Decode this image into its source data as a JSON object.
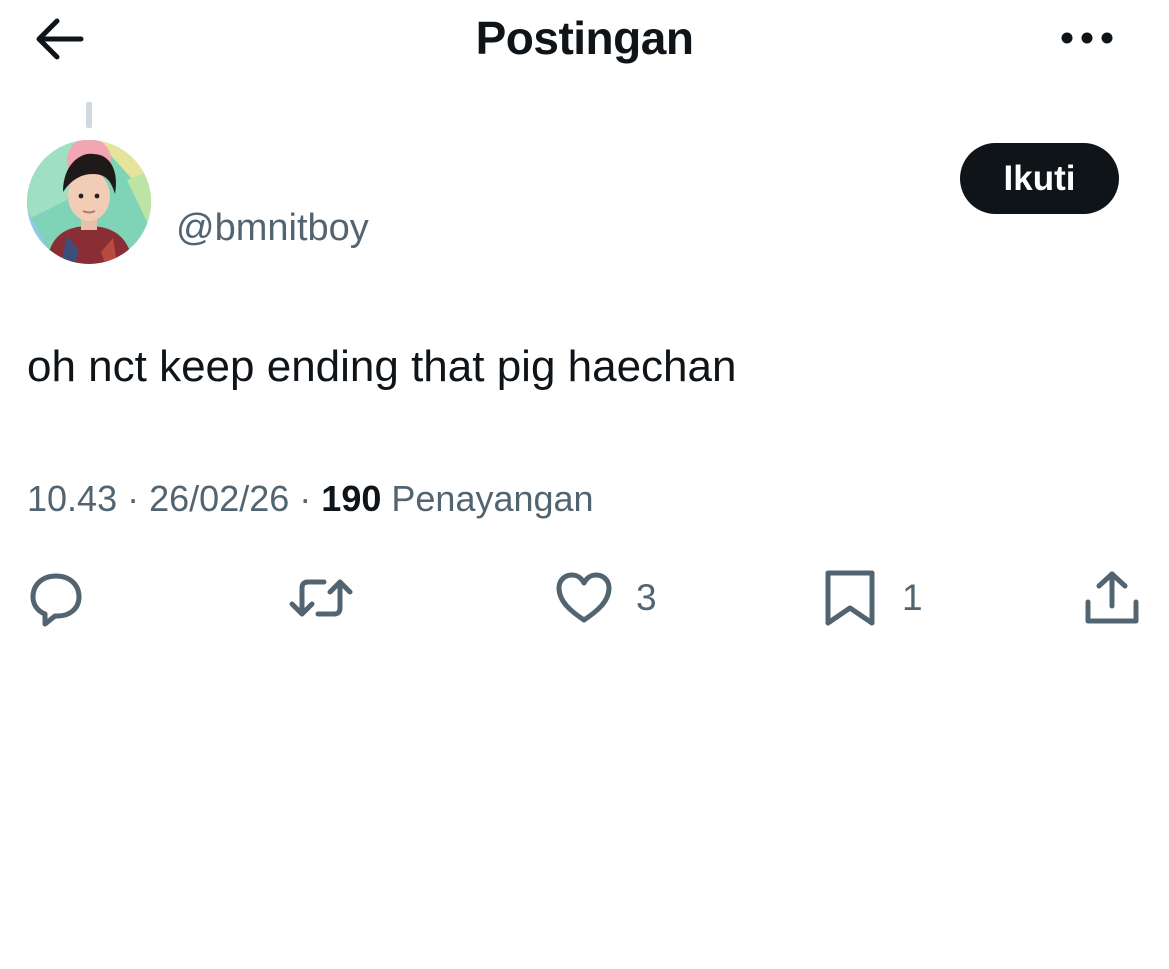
{
  "header": {
    "title": "Postingan",
    "back_icon": "arrow-left-icon",
    "more_icon": "more-horizontal-icon"
  },
  "author": {
    "handle": "@bmnitboy",
    "avatar": "profile-photo"
  },
  "follow_button": {
    "label": "Ikuti"
  },
  "post": {
    "text": "oh nct keep ending that pig haechan",
    "time": "10.43",
    "date": "26/02/26",
    "separator": "·",
    "views_count": "190",
    "views_label": "Penayangan"
  },
  "actions": {
    "reply": {
      "icon": "reply-icon",
      "count": ""
    },
    "repost": {
      "icon": "repost-icon",
      "count": ""
    },
    "like": {
      "icon": "heart-icon",
      "count": "3"
    },
    "bookmark": {
      "icon": "bookmark-icon",
      "count": "1"
    },
    "share": {
      "icon": "share-icon"
    }
  },
  "colors": {
    "text_primary": "#0f1419",
    "text_secondary": "#536471",
    "button_bg": "#0f1419",
    "button_text": "#ffffff",
    "thread_line": "#cfd9de"
  }
}
